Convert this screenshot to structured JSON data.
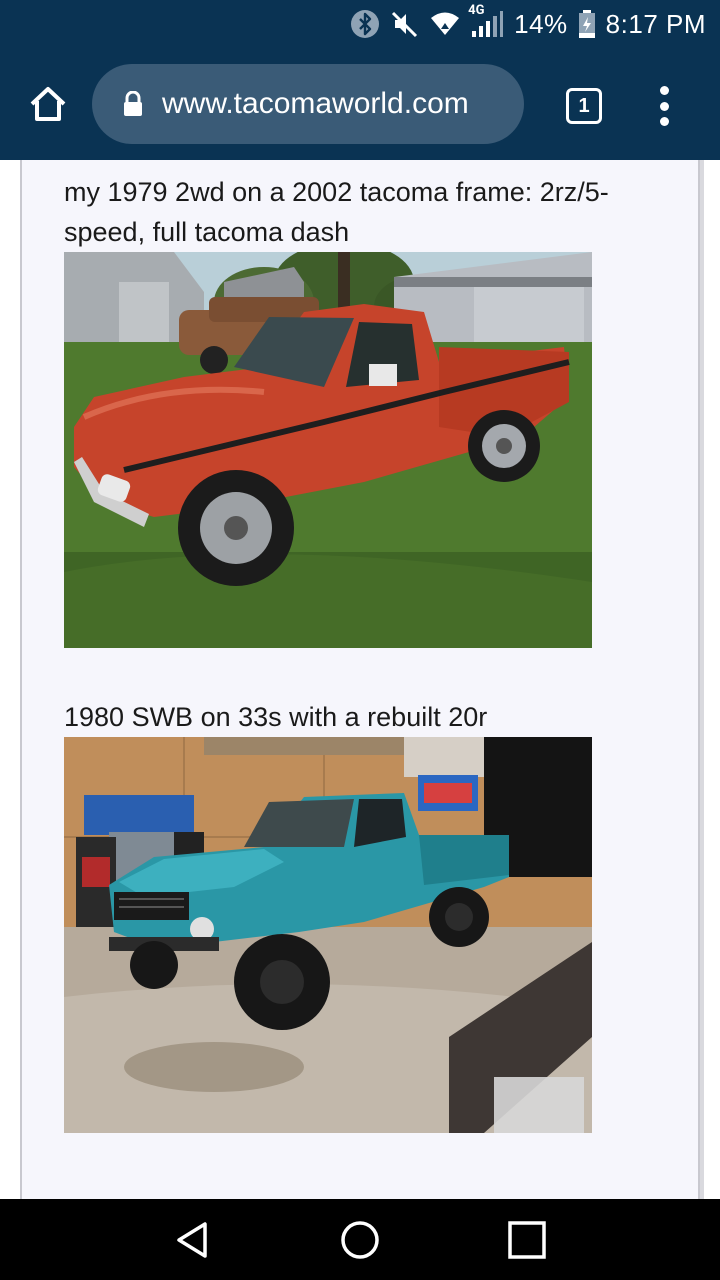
{
  "status_bar": {
    "network_label": "4G",
    "battery_text": "14%",
    "time": "8:17 PM",
    "icons": [
      "bluetooth-icon",
      "mute-icon",
      "wifi-icon",
      "signal-icon",
      "battery-icon"
    ]
  },
  "browser": {
    "url": "www.tacomaworld.com",
    "tab_count": "1",
    "toolbar_color": "#0a3353",
    "urlbar_color": "#3a5b77"
  },
  "post": {
    "items": [
      {
        "caption": "my 1979 2wd on a 2002 tacoma frame: 2rz/5-speed, full tacoma dash",
        "image_subject": "red-toyota-pickup-photo"
      },
      {
        "caption": "1980 SWB on 33s with a rebuilt 20r",
        "image_subject": "teal-toyota-pickup-photo"
      }
    ]
  },
  "nav_bar": {
    "icons": [
      "back-icon",
      "home-icon",
      "recents-icon"
    ]
  }
}
